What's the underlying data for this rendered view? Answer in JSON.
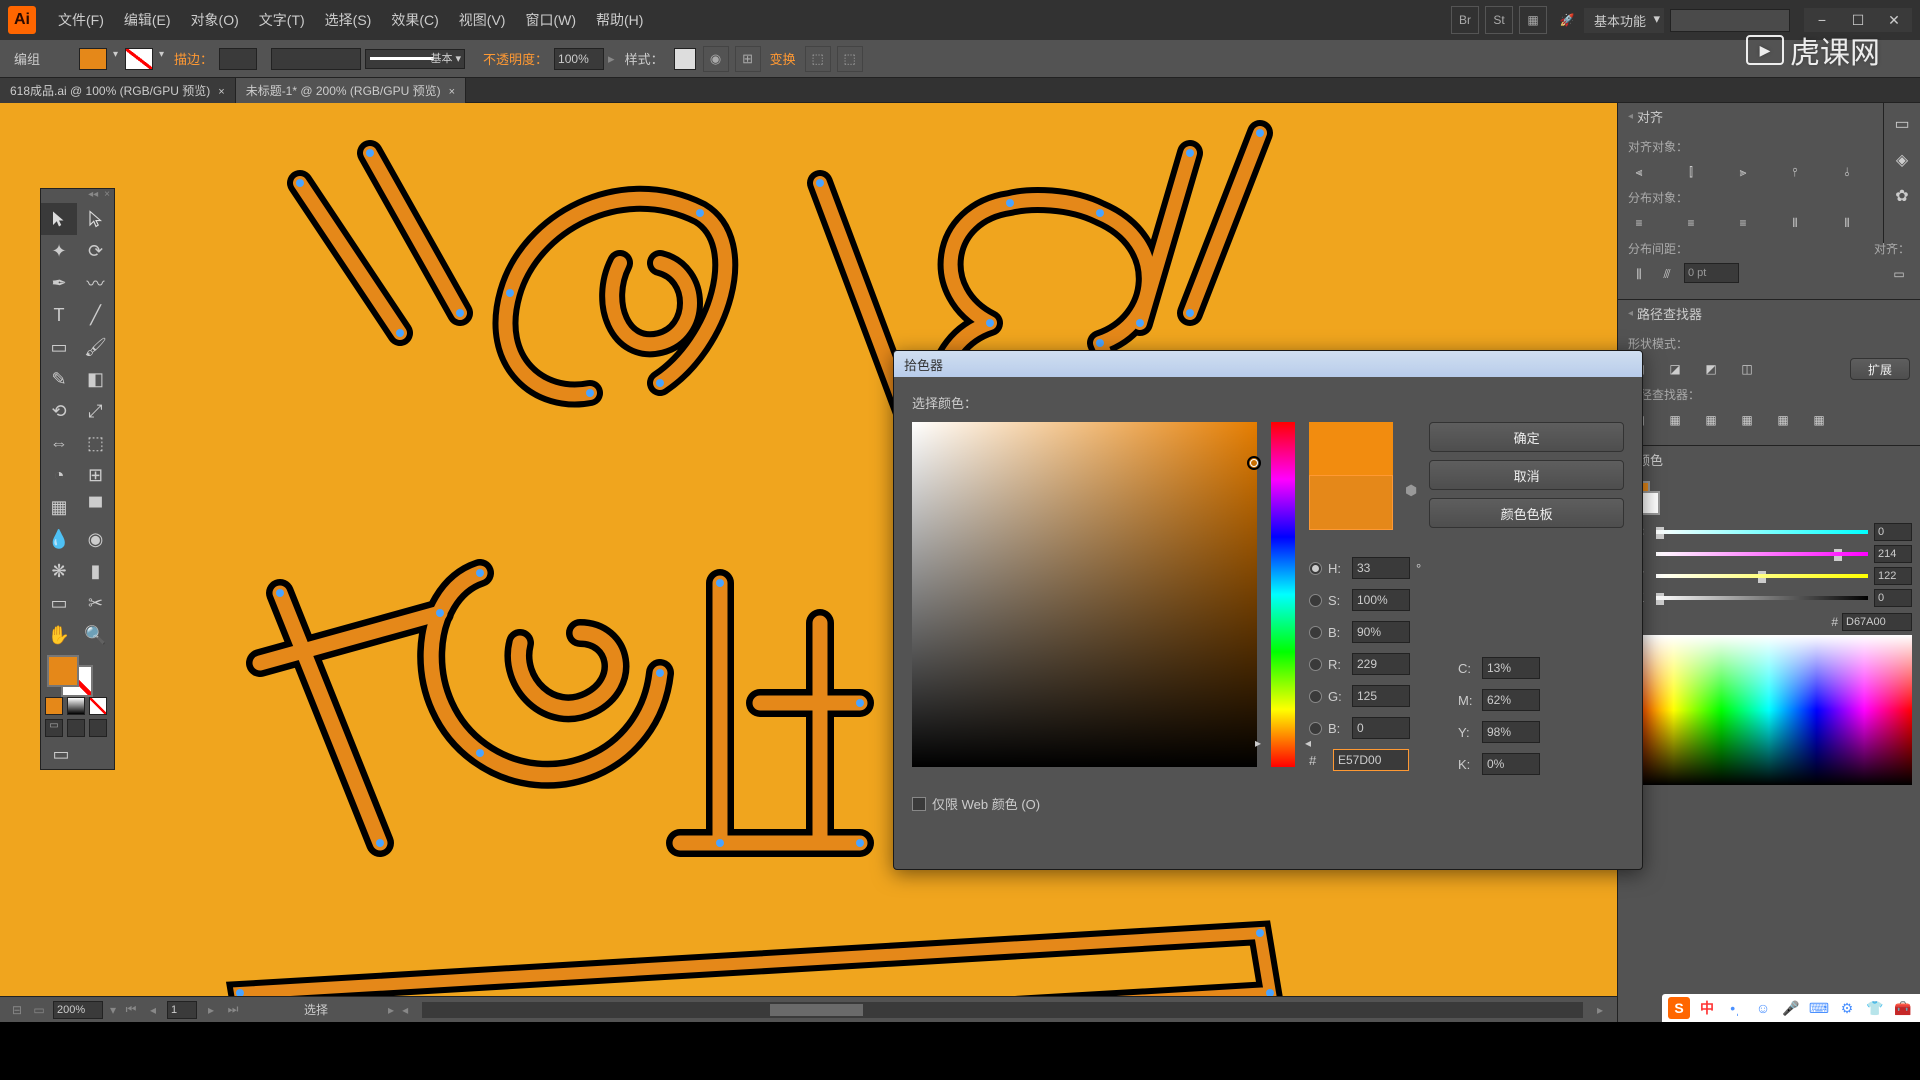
{
  "menubar": {
    "items": [
      "文件(F)",
      "编辑(E)",
      "对象(O)",
      "文字(T)",
      "选择(S)",
      "效果(C)",
      "视图(V)",
      "窗口(W)",
      "帮助(H)"
    ],
    "workspace": "基本功能"
  },
  "options": {
    "group_label": "编组",
    "stroke_label": "描边：",
    "opacity_label": "不透明度：",
    "opacity_value": "100%",
    "style_label": "样式：",
    "transform_label": "变换",
    "stroke_width": "",
    "brush": ""
  },
  "tabs": [
    {
      "name": "618成品.ai @ 100% (RGB/GPU 预览)",
      "active": false
    },
    {
      "name": "未标题-1* @ 200% (RGB/GPU 预览)",
      "active": true
    }
  ],
  "align_panel": {
    "title": "对齐",
    "align_objects": "对齐对象：",
    "distribute_objects": "分布对象：",
    "distribute_spacing": "分布间距：",
    "align_to": "对齐：",
    "spacing_value": "0 pt"
  },
  "pathfinder": {
    "title": "路径查找器",
    "shape_modes": "形状模式：",
    "expand": "扩展",
    "pathfinders": "路径查找器："
  },
  "color_panel": {
    "title": "颜色",
    "c": "0",
    "m": "214",
    "y": "122",
    "k": "0",
    "hex": "D67A00"
  },
  "picker": {
    "title": "拾色器",
    "select_label": "选择颜色：",
    "ok": "确定",
    "cancel": "取消",
    "swatches": "颜色色板",
    "h_label": "H:",
    "h_val": "33",
    "h_unit": "°",
    "s_label": "S:",
    "s_val": "100%",
    "b_label": "B:",
    "b_val": "90%",
    "r_label": "R:",
    "r_val": "229",
    "g_label": "G:",
    "g_val": "125",
    "bb_label": "B:",
    "bb_val": "0",
    "c_label": "C:",
    "c_val": "13%",
    "m_label": "M:",
    "m_val": "62%",
    "y_label": "Y:",
    "y_val": "98%",
    "k_label": "K:",
    "k_val": "0%",
    "hex_label": "#",
    "hex_val": "E57D00",
    "web_only": "仅限 Web 颜色 (O)"
  },
  "status": {
    "zoom": "200%",
    "page": "1",
    "mode": "选择"
  },
  "ime": {
    "lang": "中"
  },
  "watermark": "虎课网"
}
